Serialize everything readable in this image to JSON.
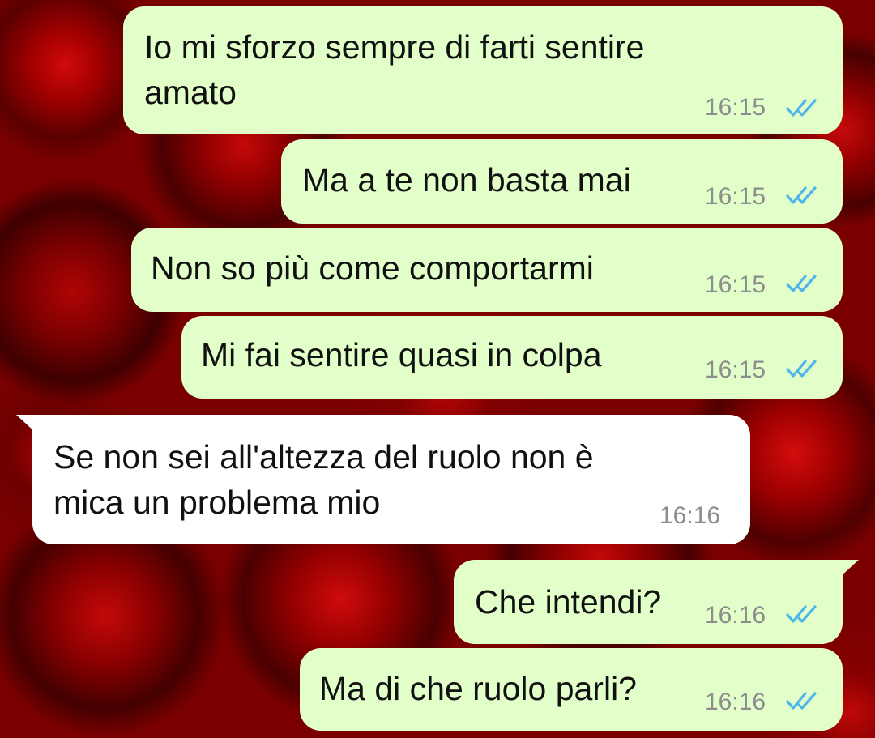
{
  "messages": [
    {
      "direction": "outgoing",
      "lines": [
        "Io mi sforzo sempre di farti sentire",
        "amato"
      ],
      "time": "16:15",
      "status": "read"
    },
    {
      "direction": "outgoing",
      "lines": [
        "Ma a te non basta mai"
      ],
      "time": "16:15",
      "status": "read"
    },
    {
      "direction": "outgoing",
      "lines": [
        "Non so più come comportarmi"
      ],
      "time": "16:15",
      "status": "read"
    },
    {
      "direction": "outgoing",
      "lines": [
        "Mi fai sentire quasi in colpa"
      ],
      "time": "16:15",
      "status": "read"
    },
    {
      "direction": "incoming",
      "lines": [
        "Se non sei all'altezza del ruolo non è",
        "mica un problema mio"
      ],
      "time": "16:16"
    },
    {
      "direction": "outgoing",
      "lines": [
        "Che intendi?"
      ],
      "time": "16:16",
      "status": "read"
    },
    {
      "direction": "outgoing",
      "lines": [
        "Ma di che ruolo parli?"
      ],
      "time": "16:16",
      "status": "read"
    }
  ],
  "colors": {
    "outgoing_bubble": "#e2ffc9",
    "incoming_bubble": "#ffffff",
    "read_ticks": "#4fb6ec",
    "timestamp": "#8d8d8d",
    "wallpaper": "#7a0000"
  },
  "icons": {
    "read_receipt": "double-check-icon",
    "wallpaper": "red-roses-wallpaper"
  }
}
